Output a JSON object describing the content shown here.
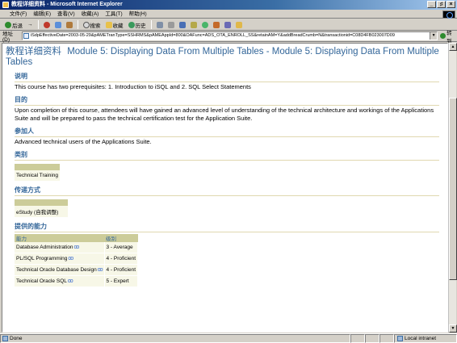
{
  "window": {
    "title": "教程详细资料 - Microsoft Internet Explorer",
    "controls": [
      "_",
      "♯",
      "×"
    ]
  },
  "menu": [
    "文件(F)",
    "编辑(E)",
    "查看(V)",
    "收藏(A)",
    "工具(T)",
    "帮助(H)"
  ],
  "toolbar": {
    "back": "后退",
    "forward": "→",
    "search": "搜索",
    "favorites": "收藏",
    "history": "历史"
  },
  "address": {
    "label": "地址(D)",
    "url": "iSdpEffectiveDate=2003-05-29&pAMETranType=SSHRMS&pAMEAppId=800&OAFunc=ADS_OTA_ENROLL_SS&retainAM=Y&addBreadCrumb=N&transactionid=C08D4FB023007D09",
    "go": "转到"
  },
  "page": {
    "title_cn": "教程详细资料",
    "title": "Module 5: Displaying Data From Multiple Tables - Module 5: Displaying Data From Multiple Tables",
    "sections": {
      "description": {
        "heading": "说明",
        "text": "This course has two prerequisites: 1. Introduction to iSQL and 2. SQL Select Statements"
      },
      "objective": {
        "heading": "目的",
        "text": "Upon completion of this course, attendees will have gained an advanced level of understanding of the technical architecture and workings of the Applications Suite and will be prepared to pass the technical certification test for the Application Suite."
      },
      "audience": {
        "heading": "参加人",
        "text": "Advanced technical users of the Applications Suite."
      },
      "category": {
        "heading": "类别",
        "value": "Technical Training"
      },
      "delivery": {
        "heading": "传递方式",
        "value": "eStudy (自我调整)"
      },
      "competencies": {
        "heading": "提供的能力",
        "columns": [
          "能力",
          "级别"
        ],
        "rows": [
          {
            "skill": "Database Administration",
            "level": "3 - Average"
          },
          {
            "skill": "PL/SQL Programming",
            "level": "4 - Proficient"
          },
          {
            "skill": "Technical Oracle Database Design",
            "level": "4 - Proficient"
          },
          {
            "skill": "Technical Oracle SQL",
            "level": "5 - Expert"
          }
        ]
      }
    }
  },
  "status": {
    "left": "Done",
    "zone": "Local intranet"
  }
}
